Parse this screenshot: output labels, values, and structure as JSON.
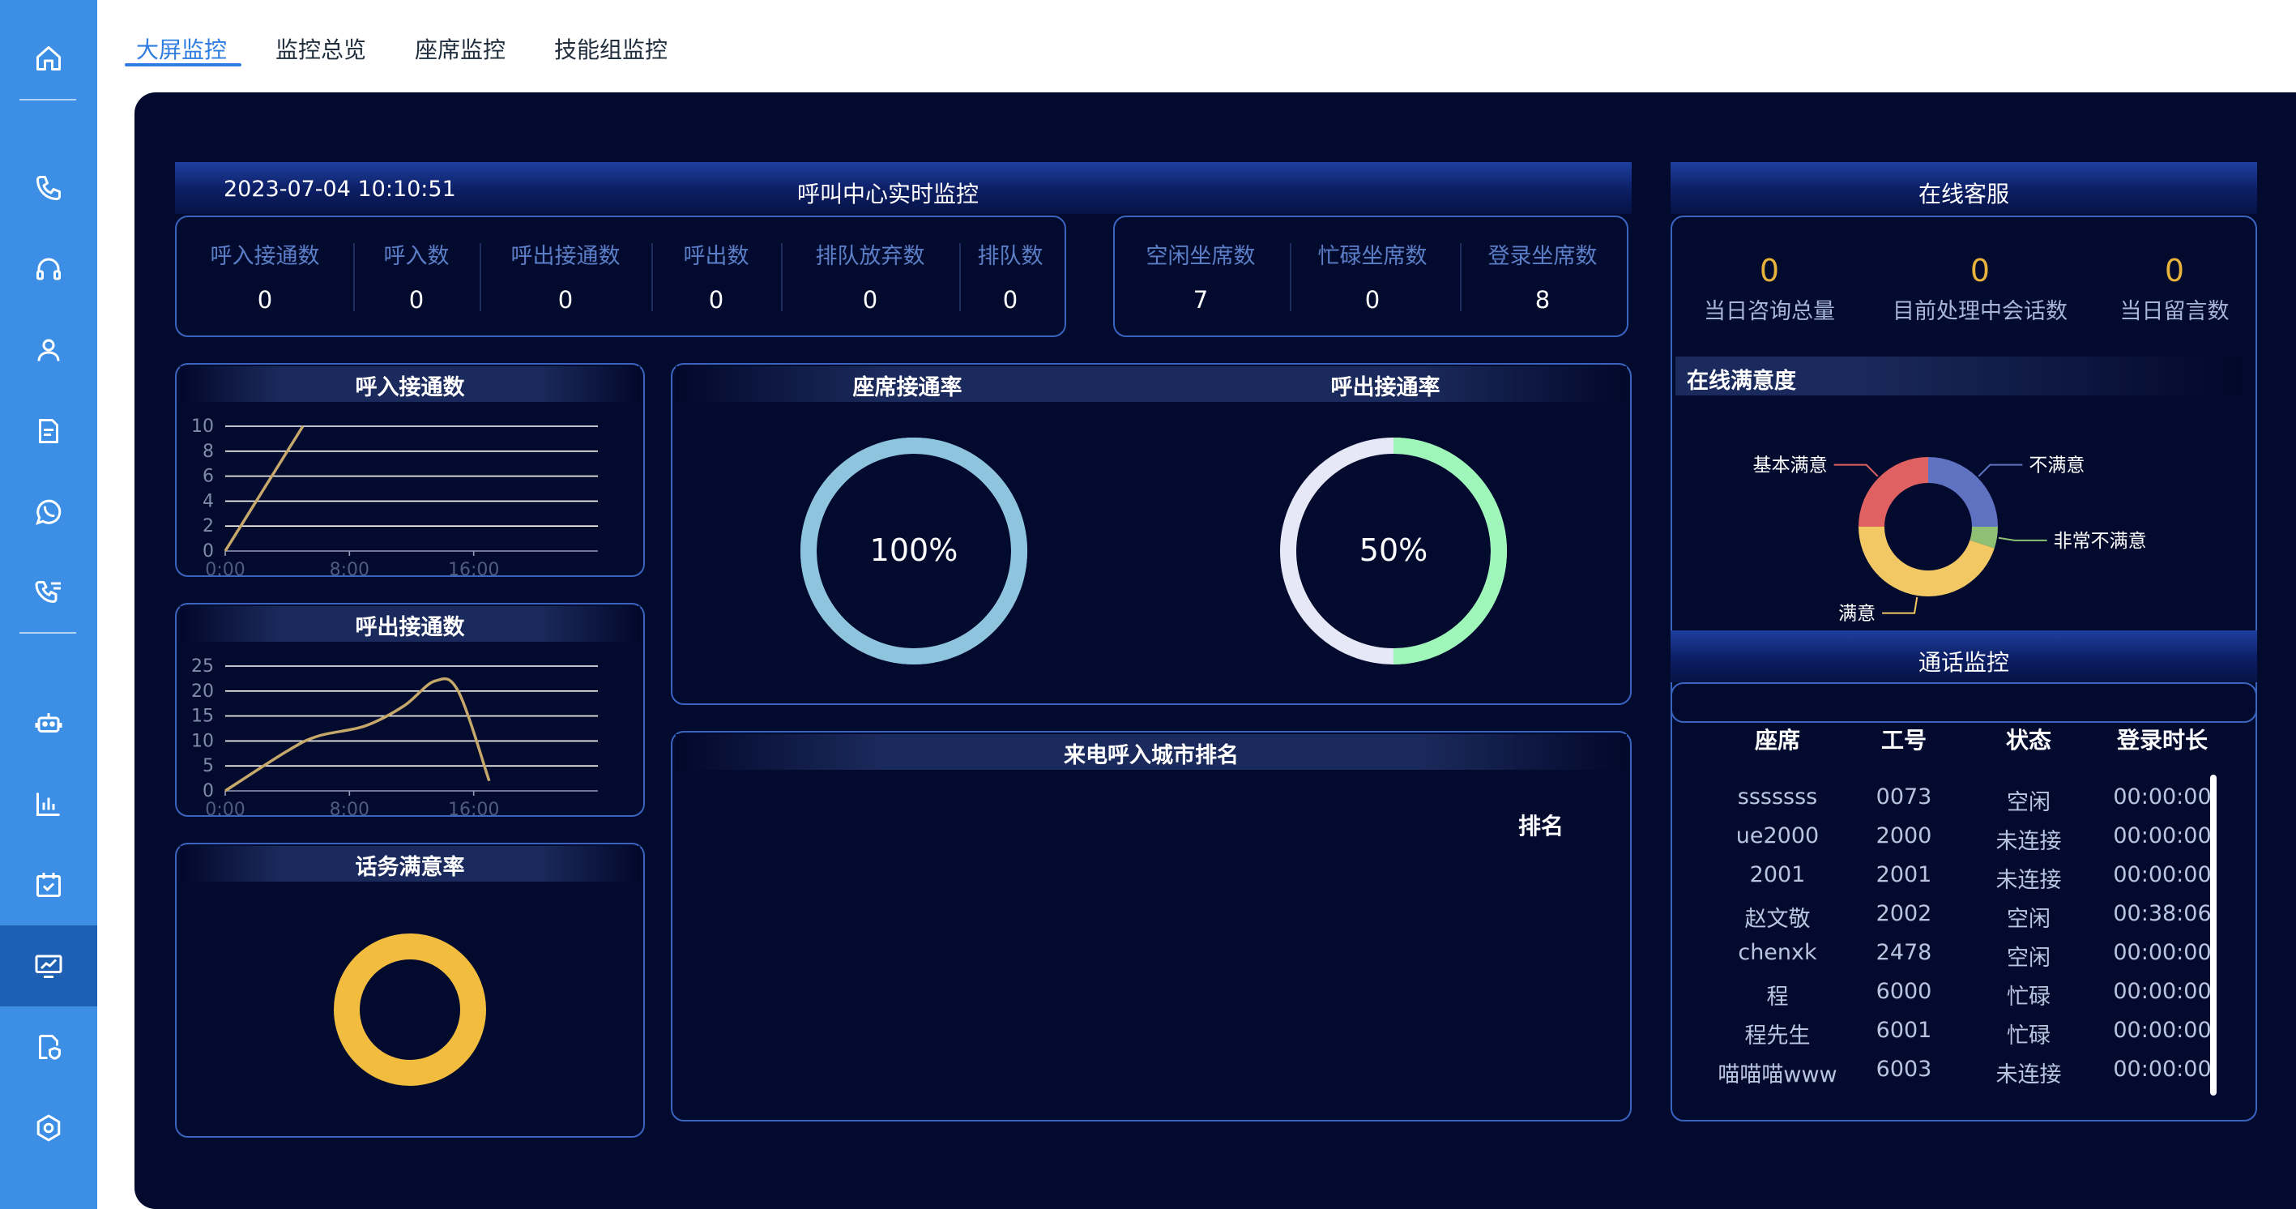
{
  "sidebar": {
    "items": [
      {
        "icon": "home-icon"
      },
      {
        "icon": "phone-icon"
      },
      {
        "icon": "headset-icon"
      },
      {
        "icon": "user-icon"
      },
      {
        "icon": "document-icon"
      },
      {
        "icon": "whatsapp-icon"
      },
      {
        "icon": "call-list-icon"
      },
      {
        "icon": "robot-icon"
      },
      {
        "icon": "bar-chart-icon"
      },
      {
        "icon": "calendar-check-icon"
      },
      {
        "icon": "monitor-chart-icon"
      },
      {
        "icon": "shield-document-icon"
      },
      {
        "icon": "settings-icon"
      }
    ],
    "active_index": 10
  },
  "tabs": [
    {
      "label": "大屏监控",
      "active": true
    },
    {
      "label": "监控总览",
      "active": false
    },
    {
      "label": "座席监控",
      "active": false
    },
    {
      "label": "技能组监控",
      "active": false
    }
  ],
  "header": {
    "datetime": "2023-07-04 10:10:51",
    "title": "呼叫中心实时监控",
    "online_title": "在线客服"
  },
  "stats_left": [
    {
      "label": "呼入接通数",
      "value": "0"
    },
    {
      "label": "呼入数",
      "value": "0"
    },
    {
      "label": "呼出接通数",
      "value": "0"
    },
    {
      "label": "呼出数",
      "value": "0"
    },
    {
      "label": "排队放弃数",
      "value": "0"
    },
    {
      "label": "排队数",
      "value": "0"
    }
  ],
  "stats_right": [
    {
      "label": "空闲坐席数",
      "value": "7"
    },
    {
      "label": "忙碌坐席数",
      "value": "0"
    },
    {
      "label": "登录坐席数",
      "value": "8"
    }
  ],
  "online": {
    "stats": [
      {
        "label": "当日咨询总量",
        "value": "0"
      },
      {
        "label": "目前处理中会话数",
        "value": "0"
      },
      {
        "label": "当日留言数",
        "value": "0"
      }
    ],
    "satisfaction_title": "在线满意度"
  },
  "panels": {
    "inbound_title": "呼入接通数",
    "outbound_title": "呼出接通数",
    "satisfaction_title": "话务满意率",
    "seat_rate_title": "座席接通率",
    "outbound_rate_title": "呼出接通率",
    "city_rank_title": "来电呼入城市排名",
    "city_rank_label": "排名",
    "call_monitor_title": "通话监控"
  },
  "gauges": {
    "seat_rate": {
      "value": 100,
      "label": "100%"
    },
    "outbound_rate": {
      "value": 50,
      "label": "50%"
    }
  },
  "colors": {
    "panel_bg": "#020a2e",
    "panel_border": "#3a64c0",
    "line": "#c7a86b",
    "seat_gauge": "#8ec4dd",
    "outbound_fill": "#9ef7b9",
    "outbound_track": "#e6e8f7",
    "satisfaction_ring": "#f2bd3f"
  },
  "chart_data": [
    {
      "type": "line",
      "title": "呼入接通数",
      "x_ticks": [
        "0:00",
        "8:00",
        "16:00"
      ],
      "y_ticks": [
        0,
        2,
        4,
        6,
        8,
        10
      ],
      "ylim": [
        0,
        10
      ],
      "xlim": [
        0,
        24
      ],
      "series": [
        {
          "x": [
            0,
            5
          ],
          "y": [
            0,
            10
          ]
        }
      ]
    },
    {
      "type": "line",
      "title": "呼出接通数",
      "x_ticks": [
        "0:00",
        "8:00",
        "16:00"
      ],
      "y_ticks": [
        0,
        5,
        10,
        15,
        20,
        25
      ],
      "ylim": [
        0,
        25
      ],
      "xlim": [
        0,
        24
      ],
      "series": [
        {
          "x": [
            0,
            4,
            6,
            9,
            11.5,
            13.5,
            15,
            17
          ],
          "y": [
            0,
            8,
            11,
            13,
            17,
            22,
            20,
            2
          ]
        }
      ]
    },
    {
      "type": "pie",
      "title": "在线满意度",
      "categories": [
        "不满意",
        "非常不满意",
        "满意",
        "基本满意"
      ],
      "values": [
        25,
        5,
        45,
        25
      ],
      "colors": [
        "#5f72c2",
        "#8fbf73",
        "#f2c865",
        "#e06161"
      ]
    }
  ],
  "call_monitor": {
    "columns": [
      "座席",
      "工号",
      "状态",
      "登录时长"
    ],
    "rows": [
      [
        "sssssss",
        "0073",
        "空闲",
        "00:00:00"
      ],
      [
        "ue2000",
        "2000",
        "未连接",
        "00:00:00"
      ],
      [
        "2001",
        "2001",
        "未连接",
        "00:00:00"
      ],
      [
        "赵文敬",
        "2002",
        "空闲",
        "00:38:06"
      ],
      [
        "chenxk",
        "2478",
        "空闲",
        "00:00:00"
      ],
      [
        "程",
        "6000",
        "忙碌",
        "00:00:00"
      ],
      [
        "程先生",
        "6001",
        "忙碌",
        "00:00:00"
      ],
      [
        "喵喵喵www",
        "6003",
        "未连接",
        "00:00:00"
      ]
    ]
  }
}
